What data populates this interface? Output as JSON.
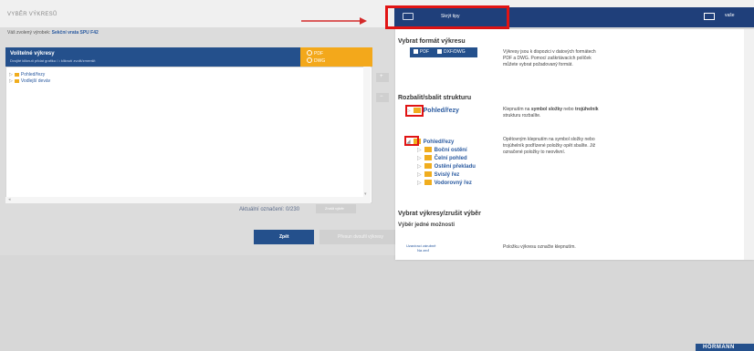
{
  "header": {
    "page_title": "VYBĚR VÝKRESŮ",
    "subtitle_prefix": "Váš zvolený výrobek:",
    "subtitle_product": "Sekční vrata SPU F42",
    "tips_label": "Skrýt tipy",
    "user_label": "vaše"
  },
  "panel": {
    "title": "Volitelné výkresy",
    "hint": "Dvojité kliknutí přidat grafiku / • kliknutí zvolit/zmenšit",
    "format_pdf": "PDF",
    "format_dwg": "DWG",
    "tree": [
      {
        "label": "Pohled/řezy"
      },
      {
        "label": "Vodlejší deváv"
      }
    ],
    "side_add": "+",
    "side_remove": "−",
    "count_label": "Aktuální označení: 0/230",
    "clear_label": "Zrušit výběr"
  },
  "footer": {
    "back_label": "Zpět",
    "next_label": "Přesun dvoufil výkresy"
  },
  "brand": {
    "logo_text": "HÖRMANN"
  },
  "tips": {
    "section1_title": "Vybrat formát výkresu",
    "format_pdf": "PDF",
    "format_dwg": "DXF/DWG",
    "section1_desc": "Výkresy jsou k dispozici v datových formátech PDF a DWG. Pomocí zaškrtávacích políček můžete vybrat požadovaný formát.",
    "section2_title": "Rozbalit/sbalit strukturu",
    "tree_collapsed": "Pohled/řezy",
    "section2_desc1_a": "Klepnutím na ",
    "section2_desc1_b": "symbol složky",
    "section2_desc1_c": " nebo ",
    "section2_desc1_d": "trojúhelník",
    "section2_desc1_e": " strukturu rozbalíte.",
    "tree_expanded_root": "Pohled/řezy",
    "tree_children": [
      "Boční ostění",
      "Čelní pohled",
      "Ostění překladu",
      "Svislý řez",
      "Vodorovný řez"
    ],
    "section2_desc2": "Opětovným klepnutím na symbol složky nebo trojúhelník podřízené položky opět sbalíte. Již označené položky to neovlivní.",
    "section3_title": "Vybrat výkresy/zrušit výběr",
    "section3_sub": "Výběr jedné možnosti",
    "mini_tree_root": "Uzavírací zárubně",
    "mini_tree_child": "Na zeď",
    "section3_desc": "Položku výkresu označte klepnutím."
  }
}
